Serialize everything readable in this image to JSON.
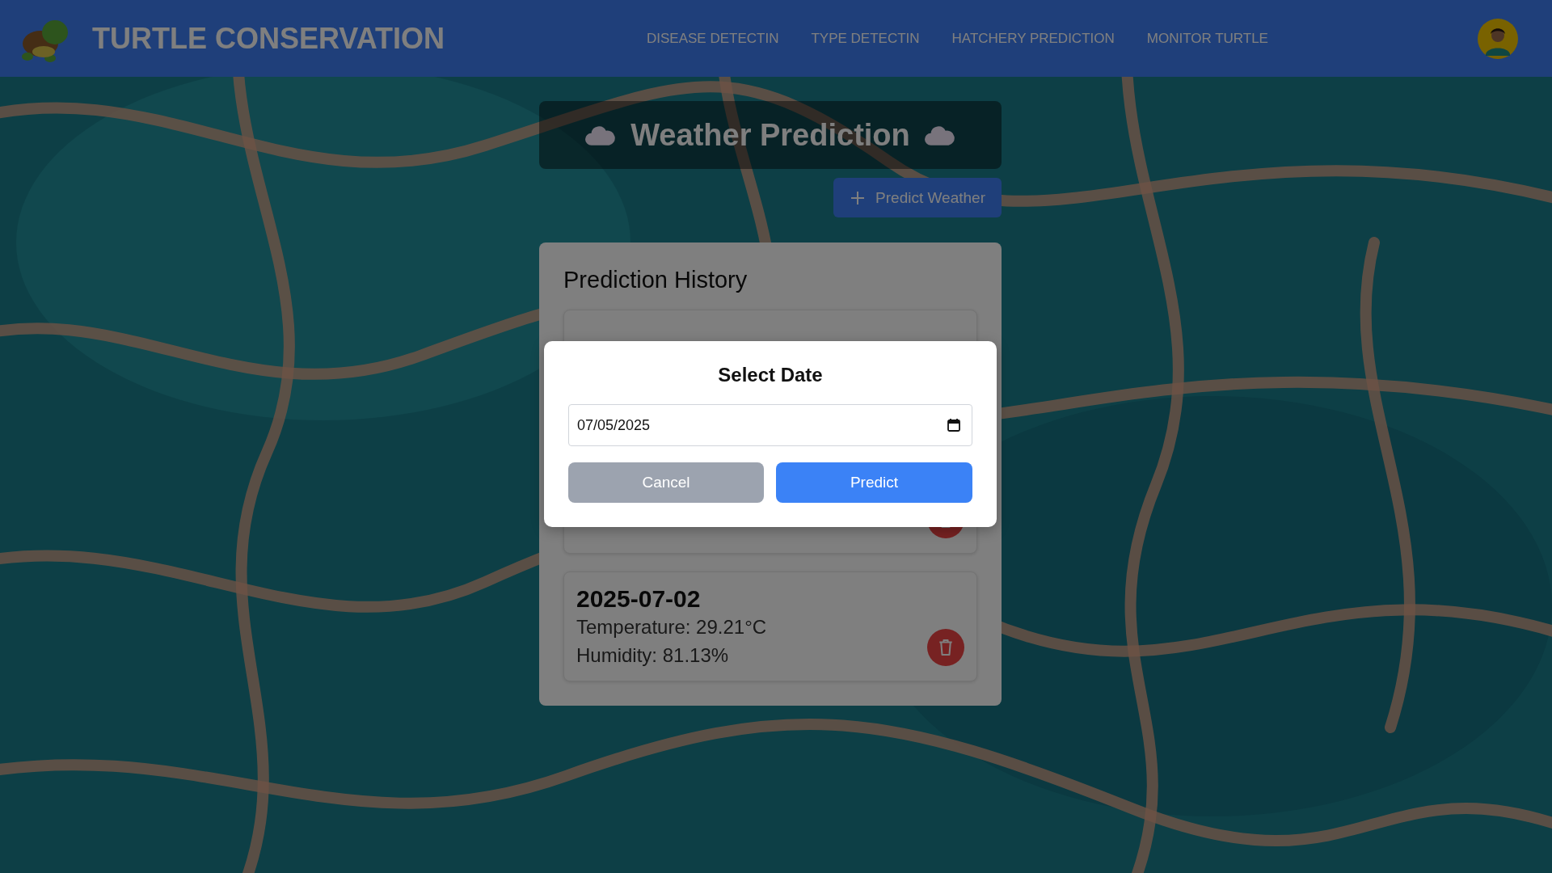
{
  "header": {
    "title": "TURTLE CONSERVATION",
    "nav": [
      {
        "label": "DISEASE DETECTIN"
      },
      {
        "label": "TYPE DETECTIN"
      },
      {
        "label": "HATCHERY PREDICTION"
      },
      {
        "label": "MONITOR TURTLE"
      }
    ]
  },
  "page": {
    "title": "Weather Prediction",
    "action": "Predict Weather"
  },
  "history": {
    "title": "Prediction History",
    "items": [
      {
        "kind": "covered"
      },
      {
        "kind": "full",
        "date": "2025-07-02",
        "temperature": "Temperature: 29.21°C",
        "humidity": "Humidity: 81.13%"
      }
    ]
  },
  "dialog": {
    "title": "Select Date",
    "date_value": "07/05/2025",
    "buttons": [
      {
        "label": "Cancel",
        "kind": "secondary"
      },
      {
        "label": "Predict",
        "kind": "primary"
      }
    ]
  }
}
